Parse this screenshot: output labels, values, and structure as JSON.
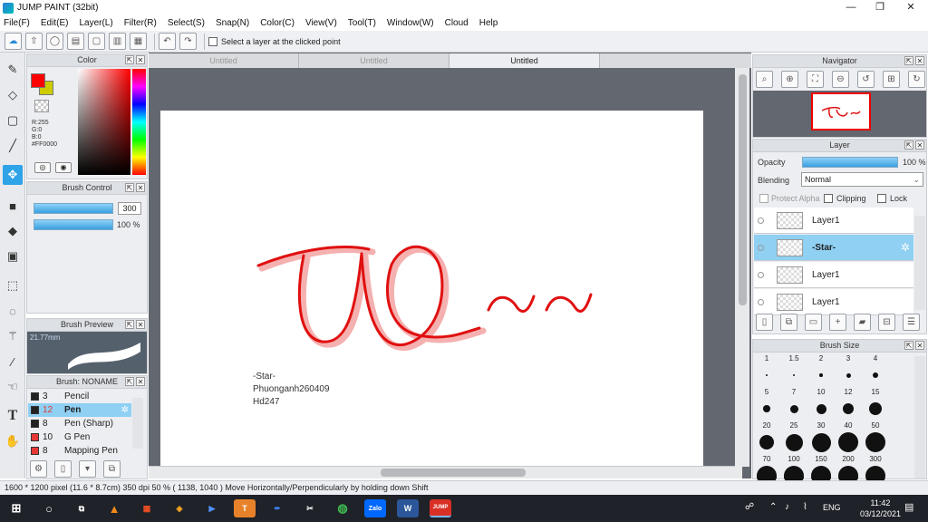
{
  "app": {
    "title": "JUMP PAINT (32bit)"
  },
  "window_controls": {
    "minimize": "—",
    "restore": "❐",
    "close": "✕"
  },
  "menu": [
    "File(F)",
    "Edit(E)",
    "Layer(L)",
    "Filter(R)",
    "Select(S)",
    "Snap(N)",
    "Color(C)",
    "View(V)",
    "Tool(T)",
    "Window(W)",
    "Cloud",
    "Help"
  ],
  "toolbar": {
    "select_layer_label": "Select a layer at the clicked point"
  },
  "tools": [
    "pen-tool",
    "eraser-tool",
    "select-rect-tool",
    "line-tool",
    "move-tool",
    "fill-rect-tool",
    "bucket-tool",
    "gradient-tool",
    "marquee-tool",
    "lasso-tool",
    "wand-tool",
    "eyedropper-tool",
    "smudge-tool",
    "text-tool",
    "hand-tool"
  ],
  "color_panel": {
    "title": "Color",
    "r": "R:255",
    "g": "G:0",
    "b": "B:0",
    "hex": "#FF0000",
    "fg": "#FF0000",
    "bg": "#CCCC00"
  },
  "brush_control": {
    "title": "Brush Control",
    "size": "300",
    "opacity": "100 %",
    "size_level": 1.0,
    "opacity_level": 1.0
  },
  "brush_preview": {
    "title": "Brush Preview",
    "size_label": "21.77mm"
  },
  "brush_list": {
    "title": "Brush: NONAME",
    "items": [
      {
        "size": "3",
        "name": "Pencil",
        "color": "#222222"
      },
      {
        "size": "12",
        "name": "Pen",
        "color": "#222222"
      },
      {
        "size": "8",
        "name": "Pen (Sharp)",
        "color": "#222222"
      },
      {
        "size": "10",
        "name": "G Pen",
        "color": "#e53935"
      },
      {
        "size": "8",
        "name": "Mapping Pen",
        "color": "#e53935"
      }
    ]
  },
  "tabs": [
    "Untitled",
    "Untitled",
    "Untitled"
  ],
  "canvas": {
    "drawing_text": "TUQ~~",
    "signature": [
      "-Star-",
      "Phuonganh260409",
      "Hd247"
    ]
  },
  "navigator": {
    "title": "Navigator"
  },
  "layer_panel": {
    "title": "Layer",
    "opacity_label": "Opacity",
    "opacity_value": "100 %",
    "opacity_level": 1.0,
    "blending_label": "Blending",
    "blending_value": "Normal",
    "protect_alpha": "Protect Alpha",
    "clipping": "Clipping",
    "lock": "Lock",
    "layers": [
      "Layer1",
      "-Star-",
      "Layer1",
      "Layer1"
    ]
  },
  "brush_size_panel": {
    "title": "Brush Size",
    "labels": [
      "1",
      "1.5",
      "2",
      "3",
      "4",
      "5",
      "7",
      "10",
      "12",
      "15",
      "20",
      "25",
      "30",
      "40",
      "50",
      "70",
      "100",
      "150",
      "200",
      "300"
    ]
  },
  "status": {
    "text": "1600 * 1200 pixel  (11.6 * 8.7cm)  350 dpi  50 %  ( 1138, 1040 )  Move Horizontally/Perpendicularly by holding down Shift"
  },
  "taskbar": {
    "lang": "ENG",
    "time": "11:42",
    "date": "03/12/2021",
    "zalo": "Zalo"
  }
}
